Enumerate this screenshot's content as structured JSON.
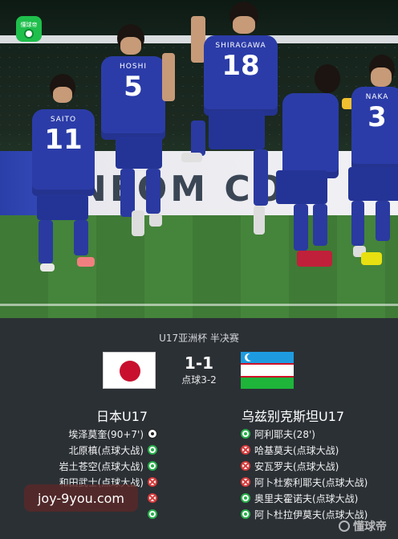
{
  "app_badge": {
    "label": "懂球帝"
  },
  "photo": {
    "board_text": "NEOM CO",
    "players": [
      {
        "name": "SAITO",
        "number": "11"
      },
      {
        "name": "HOSHI",
        "number": "5"
      },
      {
        "name": "SHIRAGAWA",
        "number": "18"
      },
      {
        "name": "",
        "number": ""
      },
      {
        "name": "NAKA",
        "number": "3"
      }
    ]
  },
  "match": {
    "competition": "U17亚洲杯 半决赛",
    "score": "1-1",
    "penalties": "点球3-2",
    "home": {
      "name": "日本U17",
      "flag": "japan",
      "events": [
        {
          "text": "埃泽莫奎(90+7')",
          "icon": "goal"
        },
        {
          "text": "北原槙(点球大战)",
          "icon": "penalty-scored"
        },
        {
          "text": "岩土苍空(点球大战)",
          "icon": "penalty-scored"
        },
        {
          "text": "和田武士(点球大战)",
          "icon": "penalty-missed"
        },
        {
          "text": "",
          "icon": "penalty-missed"
        },
        {
          "text": "",
          "icon": "penalty-scored"
        }
      ]
    },
    "away": {
      "name": "乌兹别克斯坦U17",
      "flag": "uzbekistan",
      "events": [
        {
          "text": "阿利耶夫(28')",
          "icon": "goal"
        },
        {
          "text": "哈基莫夫(点球大战)",
          "icon": "penalty-missed"
        },
        {
          "text": "安瓦罗夫(点球大战)",
          "icon": "penalty-missed"
        },
        {
          "text": "阿卜杜索利耶夫(点球大战)",
          "icon": "penalty-missed"
        },
        {
          "text": "奥里夫霍诺夫(点球大战)",
          "icon": "penalty-scored"
        },
        {
          "text": "阿卜杜拉伊莫夫(点球大战)",
          "icon": "penalty-scored"
        }
      ]
    }
  },
  "overlay": {
    "watermark": "joy-9you.com",
    "brand": "懂球帝"
  },
  "colors": {
    "panel": "#2b3035",
    "goal_green": "#27b04a",
    "miss_red": "#d63a3a",
    "jp_red": "#c8102e",
    "uz_blue": "#1e9be0",
    "uz_green": "#1eb53a"
  }
}
